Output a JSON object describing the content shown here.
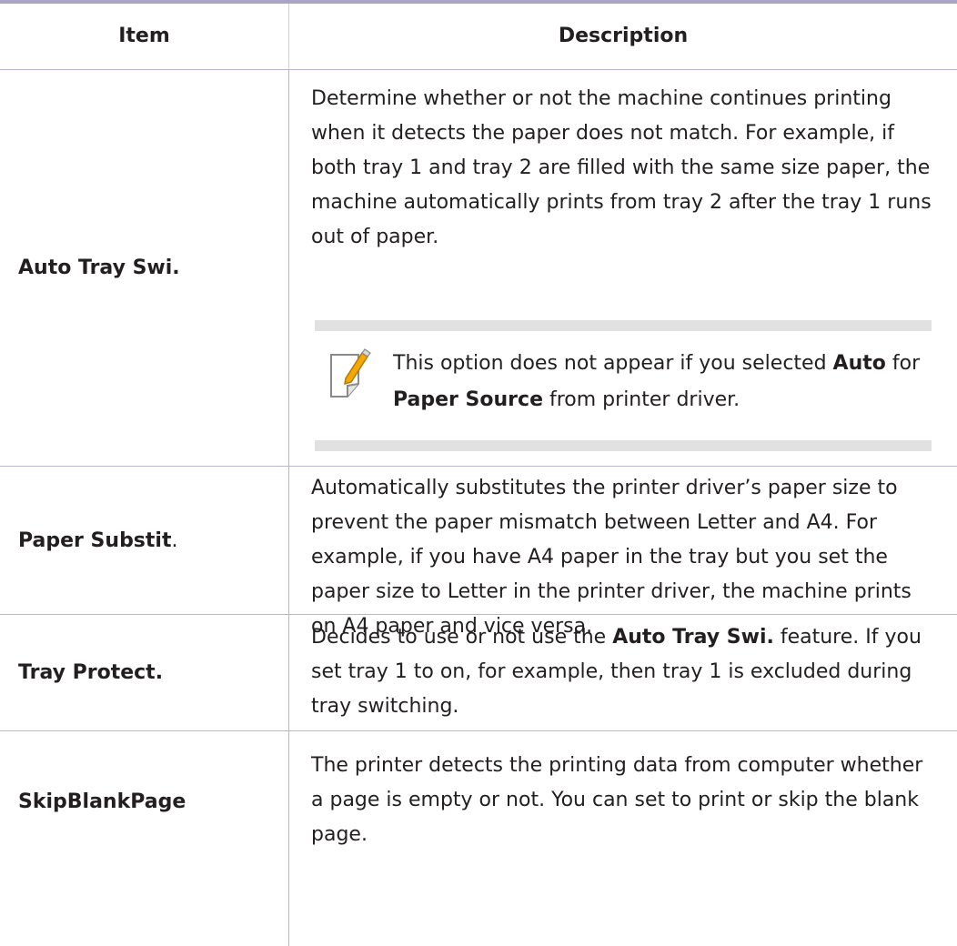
{
  "table": {
    "headers": {
      "item": "Item",
      "description": "Description"
    },
    "rows": [
      {
        "item": "Auto Tray Swi.",
        "description": "Determine whether or not the machine continues printing when it detects the paper does not match. For example, if both tray 1 and tray 2 are filled with the same size paper, the machine automatically prints from tray 2 after the tray 1 runs out of paper.",
        "note": {
          "pre": "This option does not appear if you selected ",
          "bold1": "Auto",
          "mid": " for ",
          "bold2": "Paper Source",
          "post": " from printer driver."
        }
      },
      {
        "item": "Paper Substit",
        "item_suffix": ".",
        "description": "Automatically substitutes the printer driver’s paper size to prevent the paper mismatch between Letter and A4. For example, if you have A4 paper in the tray but you set the paper size to Letter in the printer driver, the machine prints on A4 paper and vice versa."
      },
      {
        "item": "Tray Protect.",
        "description_pre": "Decides to use or not use the ",
        "description_bold": "Auto Tray Swi.",
        "description_post": " feature. If you set tray 1 to on, for example, then tray 1 is excluded during tray switching."
      },
      {
        "item": "SkipBlankPage",
        "description": "The printer detects the printing data from computer whether a page is empty or not. You can set to print or skip the blank page."
      }
    ]
  },
  "icons": {
    "note": "note-pencil-icon"
  },
  "colors": {
    "rule": "#b7b4d4",
    "top_rule": "#a8a5c9",
    "note_band": "#e1e1e1",
    "pencil": "#f5a800"
  }
}
